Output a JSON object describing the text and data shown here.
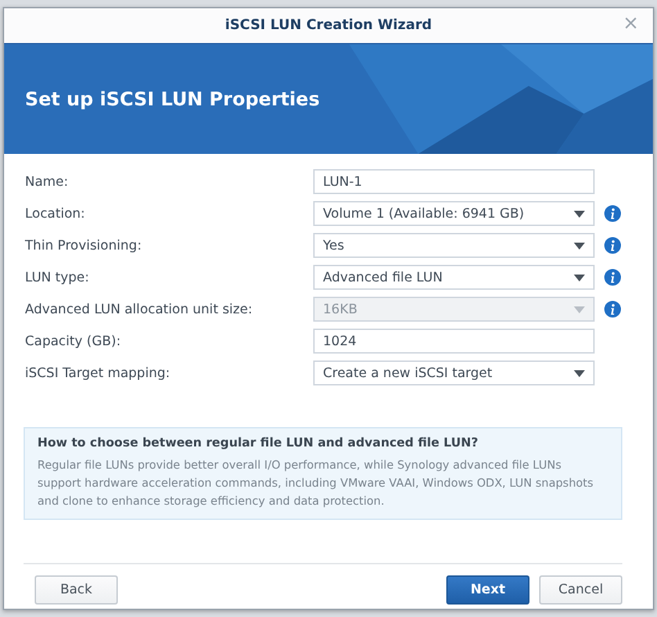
{
  "window": {
    "title": "iSCSI LUN Creation Wizard",
    "close": "×"
  },
  "banner": {
    "heading": "Set up iSCSI LUN Properties"
  },
  "fields": [
    {
      "label": "Name:",
      "kind": "text",
      "value": "LUN-1",
      "disabled": false,
      "info": false
    },
    {
      "label": "Location:",
      "kind": "select",
      "value": "Volume 1 (Available: 6941 GB)",
      "disabled": false,
      "info": true
    },
    {
      "label": "Thin Provisioning:",
      "kind": "select",
      "value": "Yes",
      "disabled": false,
      "info": true
    },
    {
      "label": "LUN type:",
      "kind": "select",
      "value": "Advanced file LUN",
      "disabled": false,
      "info": true
    },
    {
      "label": "Advanced LUN allocation unit size:",
      "kind": "select",
      "value": "16KB",
      "disabled": true,
      "info": true
    },
    {
      "label": "Capacity (GB):",
      "kind": "text",
      "value": "1024",
      "disabled": false,
      "info": false
    },
    {
      "label": "iSCSI Target mapping:",
      "kind": "select",
      "value": "Create a new iSCSI target",
      "disabled": false,
      "info": false
    }
  ],
  "help": {
    "title": "How to choose between regular file LUN and advanced file LUN?",
    "text": "Regular file LUNs provide better overall I/O performance, while Synology advanced file LUNs support hardware acceleration commands, including VMware VAAI, Windows ODX, LUN snapshots and clone to enhance storage efficiency and data protection."
  },
  "buttons": [
    {
      "label": "Back",
      "kind": "secondary"
    },
    {
      "label": "Next",
      "kind": "primary"
    },
    {
      "label": "Cancel",
      "kind": "secondary"
    }
  ]
}
